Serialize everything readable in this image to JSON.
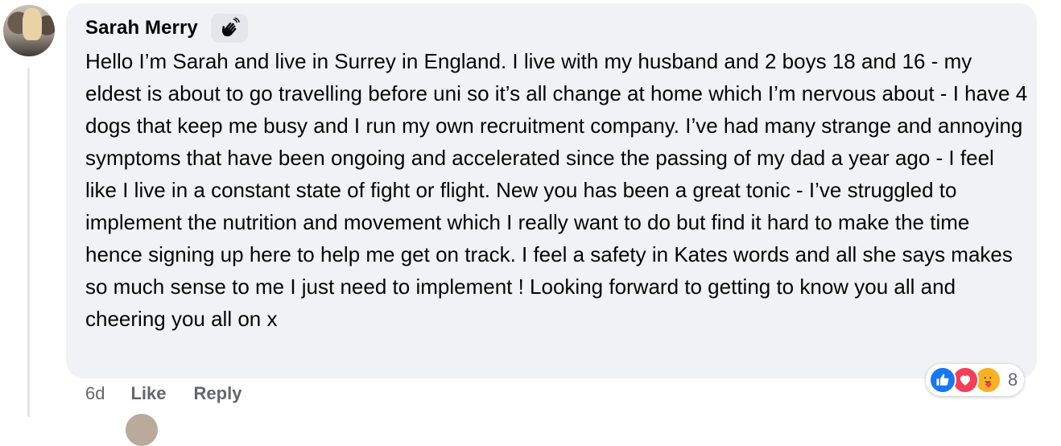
{
  "comment": {
    "author": "Sarah Merry",
    "badge_icon": "wave-hand-icon",
    "text": "Hello I’m Sarah and live in Surrey in England. I live with my husband and 2 boys 18 and 16 - my eldest is about to go travelling before uni so it’s all change at home which I’m nervous about - I have 4 dogs that keep me busy and I run my own recruitment company. I’ve had many strange and annoying symptoms that have been ongoing and accelerated since the passing of my dad a year ago - I feel like I live in a constant state of fight or flight. New you has been a great tonic - I’ve struggled to implement the nutrition and movement which I really want to do but find it hard to make the time hence signing up here to help me get on track. I feel a safety in Kates words and all she says makes so much sense to me I just need to implement ! Looking forward to getting to know you all and cheering you all on x"
  },
  "actions": {
    "time": "6d",
    "like_label": "Like",
    "reply_label": "Reply"
  },
  "reactions": {
    "icons": [
      "like-icon",
      "love-icon",
      "care-icon"
    ],
    "count": "8"
  },
  "colors": {
    "bubble": "#f0f2f5",
    "secondary_text": "#65676b",
    "like_blue": "#1877f2",
    "love_red": "#f33e58",
    "care_yellow": "#f7b125"
  }
}
